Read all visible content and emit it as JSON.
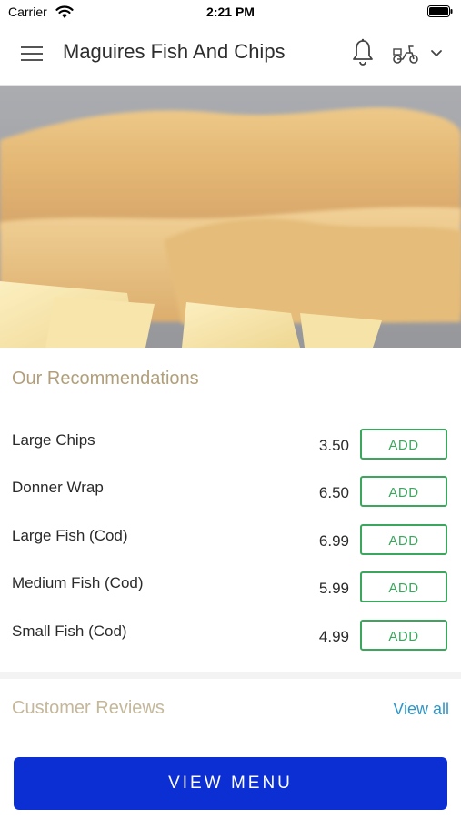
{
  "status_bar": {
    "carrier": "Carrier",
    "time": "2:21 PM"
  },
  "header": {
    "title": "Maguires Fish And Chips"
  },
  "recommendations": {
    "title": "Our Recommendations",
    "add_label": "ADD",
    "items": [
      {
        "name": "Large Chips",
        "price": "3.50"
      },
      {
        "name": "Donner Wrap",
        "price": "6.50"
      },
      {
        "name": "Large Fish (Cod)",
        "price": "6.99"
      },
      {
        "name": "Medium Fish (Cod)",
        "price": "5.99"
      },
      {
        "name": "Small Fish (Cod)",
        "price": "4.99"
      }
    ]
  },
  "reviews": {
    "title": "Customer Reviews",
    "view_all": "View all"
  },
  "footer": {
    "view_menu": "VIEW MENU"
  },
  "colors": {
    "accent_green": "#3aa75c",
    "brand_blue": "#0b2fd3",
    "heading_tan": "#b19f7b",
    "link_blue": "#2e97c9"
  },
  "icons": [
    "wifi-icon",
    "battery-icon",
    "hamburger-menu-icon",
    "bell-icon",
    "scooter-icon",
    "chevron-down-icon"
  ]
}
